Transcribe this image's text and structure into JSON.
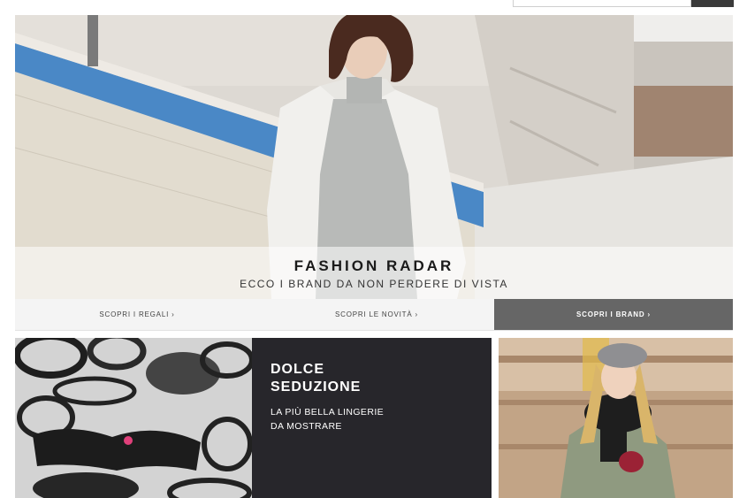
{
  "search": {
    "placeholder": ""
  },
  "hero": {
    "title": "FASHION RADAR",
    "subtitle": "ECCO I BRAND DA NON PERDERE DI VISTA"
  },
  "cta_bar": [
    {
      "label": "SCOPRI I REGALI ›"
    },
    {
      "label": "SCOPRI LE NOVITÀ ›"
    },
    {
      "label": "SCOPRI I BRAND ›"
    }
  ],
  "promo": {
    "title_line1": "DOLCE",
    "title_line2": "SEDUZIONE",
    "desc_line1": "LA PIÙ BELLA LINGERIE",
    "desc_line2": "DA MOSTRARE"
  },
  "colors": {
    "dark_panel": "#27262b",
    "active_cta": "#666666",
    "inactive_cta": "#f4f4f4"
  }
}
